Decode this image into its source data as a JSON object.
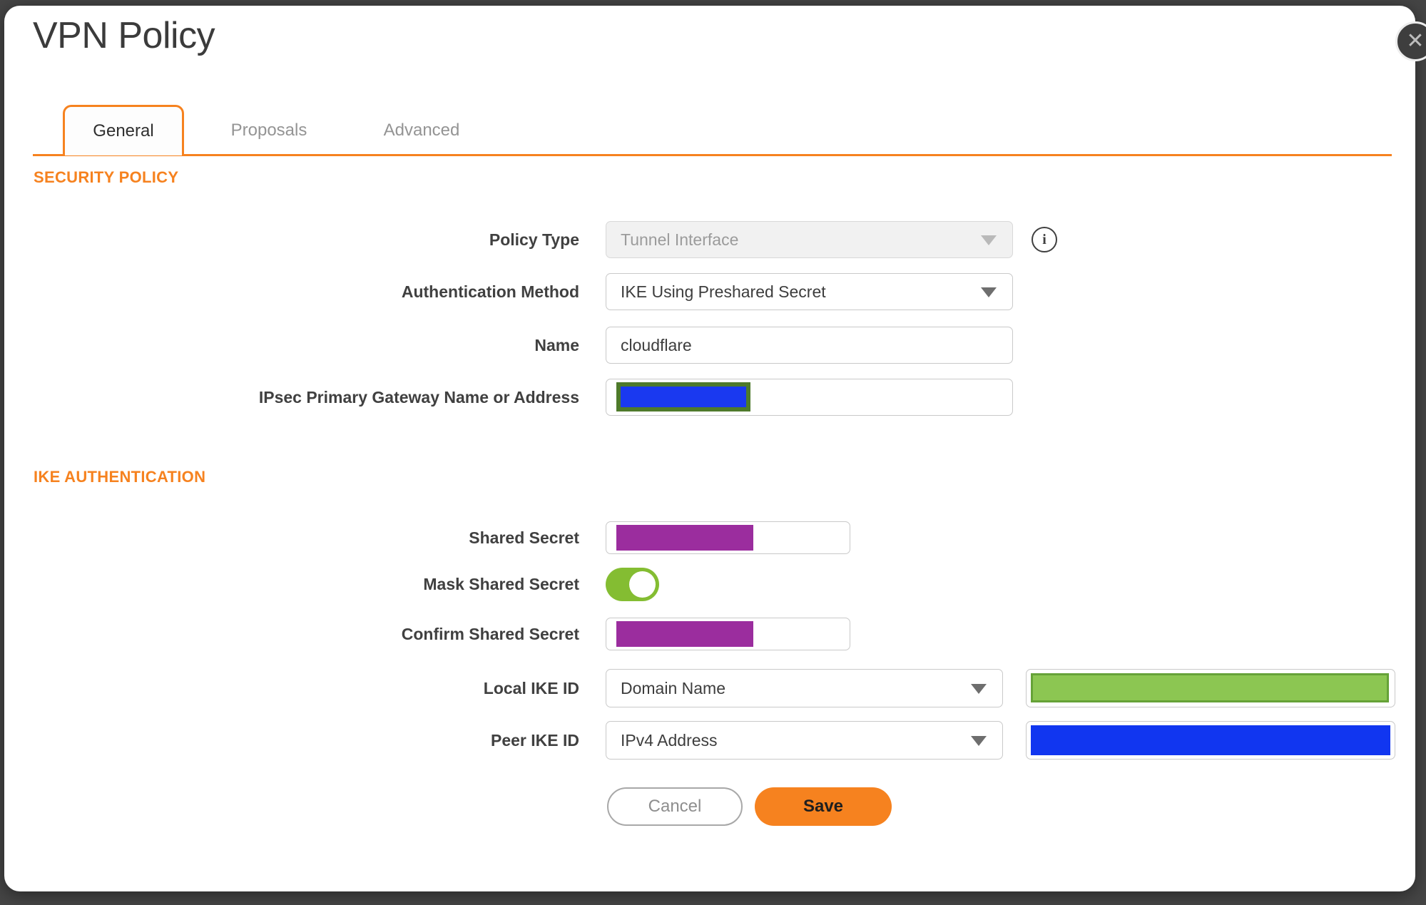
{
  "dialog": {
    "title": "VPN Policy"
  },
  "tabs": [
    {
      "label": "General",
      "active": true
    },
    {
      "label": "Proposals",
      "active": false
    },
    {
      "label": "Advanced",
      "active": false
    }
  ],
  "sections": {
    "security_policy": {
      "heading": "SECURITY POLICY"
    },
    "ike_authentication": {
      "heading": "IKE AUTHENTICATION"
    }
  },
  "fields": {
    "policy_type": {
      "label": "Policy Type",
      "value": "Tunnel Interface",
      "disabled": true
    },
    "authentication_method": {
      "label": "Authentication Method",
      "value": "IKE Using Preshared Secret"
    },
    "name": {
      "label": "Name",
      "value": "cloudflare"
    },
    "gateway": {
      "label": "IPsec Primary Gateway Name or Address",
      "value": "",
      "redacted": true
    },
    "shared_secret": {
      "label": "Shared Secret",
      "value": "",
      "redacted": true
    },
    "mask_shared_secret": {
      "label": "Mask Shared Secret",
      "enabled": true
    },
    "confirm_shared_secret": {
      "label": "Confirm Shared Secret",
      "value": "",
      "redacted": true
    },
    "local_ike_id": {
      "label": "Local IKE ID",
      "type_selected": "Domain Name",
      "value": "",
      "redacted": true
    },
    "peer_ike_id": {
      "label": "Peer IKE ID",
      "type_selected": "IPv4 Address",
      "value": "",
      "redacted": true
    }
  },
  "buttons": {
    "cancel": "Cancel",
    "save": "Save"
  },
  "icons": {
    "close": "✕",
    "info": "i"
  },
  "colors": {
    "accent_orange": "#f6821f",
    "toggle_green": "#84bd32",
    "redaction_purple": "#9b2d9e",
    "redaction_blue": "#1136f0",
    "redaction_green_fill": "#8cc652",
    "redaction_green_border": "#66a238",
    "redaction_olive_border": "#4e7a2b",
    "backdrop_gray": "#454545"
  }
}
